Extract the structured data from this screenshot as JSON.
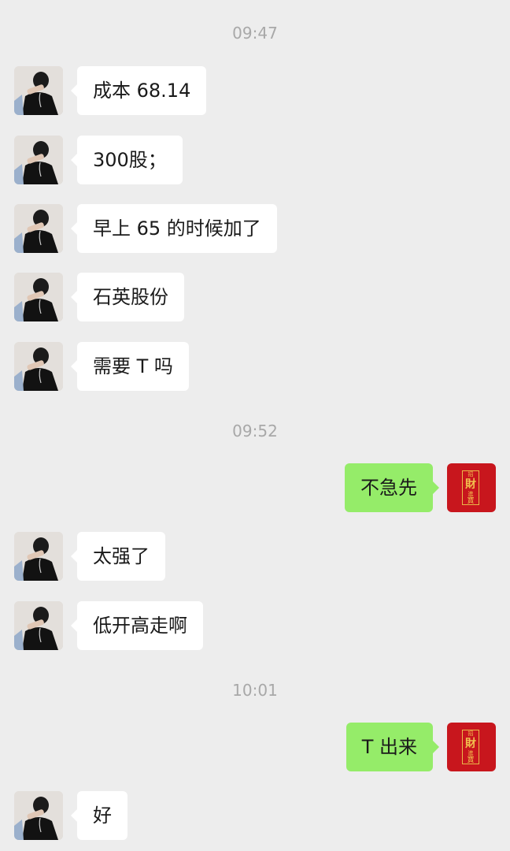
{
  "chat": {
    "timestamps": [
      "09:47",
      "09:52",
      "10:01"
    ],
    "messages": [
      {
        "side": "in",
        "text": "成本 68.14",
        "avatar": "user-photo"
      },
      {
        "side": "in",
        "text": "300股；",
        "avatar": "user-photo"
      },
      {
        "side": "in",
        "text": "早上 65 的时候加了",
        "avatar": "user-photo"
      },
      {
        "side": "in",
        "text": "石英股份",
        "avatar": "user-photo"
      },
      {
        "side": "in",
        "text": "需要 T 吗",
        "avatar": "user-photo"
      },
      {
        "side": "out",
        "text": "不急先",
        "avatar": "red-seal-logo"
      },
      {
        "side": "in",
        "text": "太强了",
        "avatar": "user-photo"
      },
      {
        "side": "in",
        "text": "低开高走啊",
        "avatar": "user-photo"
      },
      {
        "side": "out",
        "text": "T 出来",
        "avatar": "red-seal-logo"
      },
      {
        "side": "in",
        "text": "好",
        "avatar": "user-photo"
      }
    ]
  },
  "logo": {
    "chars": [
      "招",
      "財",
      "進",
      "寶"
    ]
  },
  "colors": {
    "background": "#ededed",
    "incoming_bubble": "#ffffff",
    "outgoing_bubble": "#95ec69",
    "timestamp": "#a8a8a8",
    "seal_red": "#c8161d",
    "seal_gold": "#f2c14e"
  }
}
